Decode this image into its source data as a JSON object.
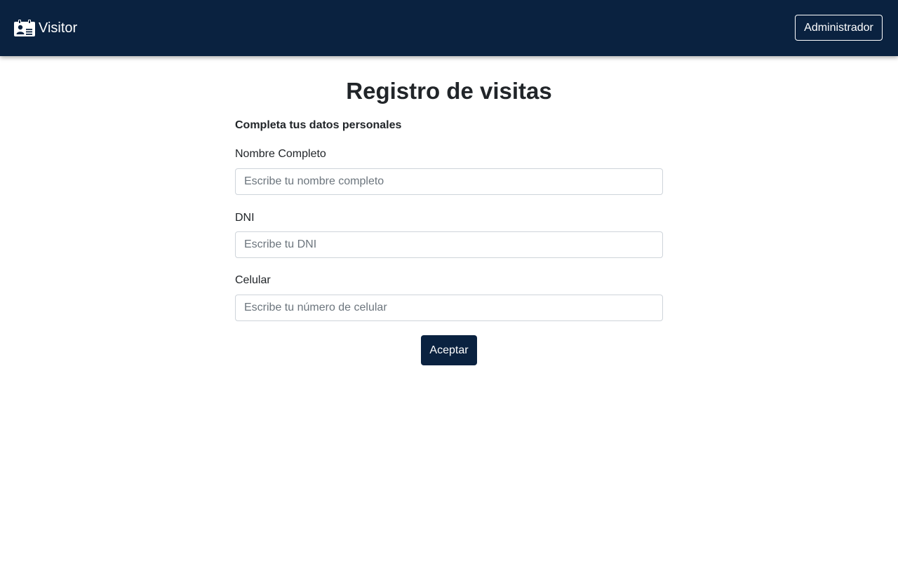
{
  "navbar": {
    "brand_text": "Visitor",
    "brand_icon": "id-card-icon",
    "admin_label": "Administrador",
    "background": "#0a2240"
  },
  "page": {
    "title": "Registro de visitas",
    "section_title": "Completa tus datos personales"
  },
  "form": {
    "name": {
      "label": "Nombre Completo",
      "placeholder": "Escribe tu nombre completo",
      "value": ""
    },
    "dni": {
      "label": "DNI",
      "placeholder": "Escribe tu DNI",
      "value": ""
    },
    "phone": {
      "label": "Celular",
      "placeholder": "Escribe tu número de celular",
      "value": ""
    },
    "submit_label": "Aceptar"
  },
  "colors": {
    "primary": "#0a2240",
    "text": "#212529",
    "input_border": "#ced4da"
  }
}
